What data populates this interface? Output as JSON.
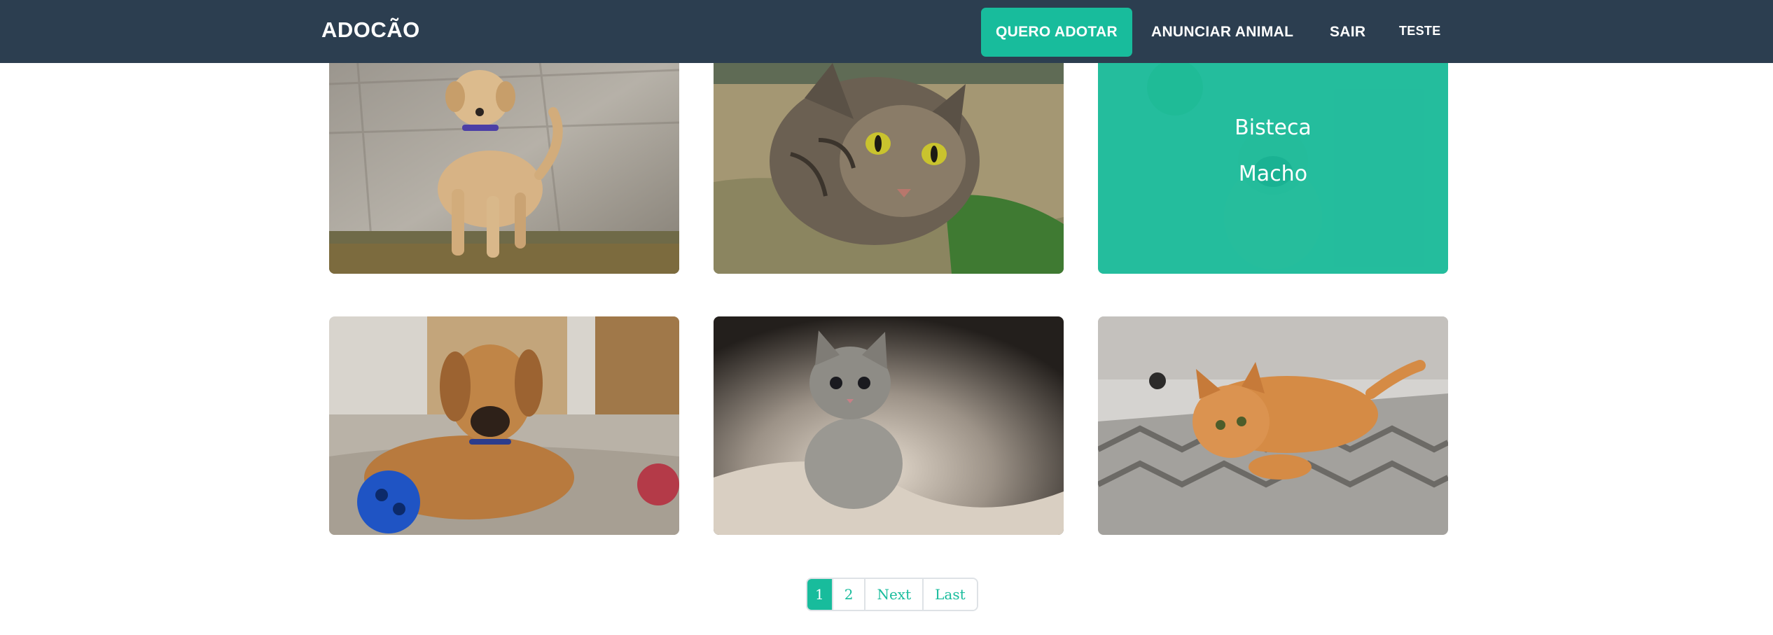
{
  "nav": {
    "brand": "ADOCÃO",
    "items": [
      {
        "label": "QUERO ADOTAR",
        "active": true
      },
      {
        "label": "ANUNCIAR ANIMAL",
        "active": false
      },
      {
        "label": "SAIR",
        "active": false
      },
      {
        "label": "TESTE",
        "active": false
      }
    ]
  },
  "cards": [
    {
      "image": "labrador-dog-photo"
    },
    {
      "image": "tabby-cat-photo"
    },
    {
      "image": "pug-dog-photo",
      "overlay": {
        "name": "Bisteca",
        "sex": "Macho"
      }
    },
    {
      "image": "puppy-with-ball-photo"
    },
    {
      "image": "gray-kitten-photo"
    },
    {
      "image": "orange-cat-photo"
    }
  ],
  "pagination": {
    "pages": [
      "1",
      "2"
    ],
    "current": "1",
    "next": "Next",
    "last": "Last"
  },
  "colors": {
    "navbar": "#2c3e50",
    "accent": "#18bc9c"
  }
}
